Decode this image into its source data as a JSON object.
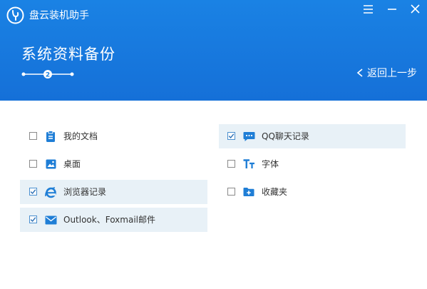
{
  "app": {
    "name": "盘云装机助手",
    "icon": "logo-icon"
  },
  "window_controls": [
    {
      "name": "menu-icon"
    },
    {
      "name": "minimize-icon"
    },
    {
      "name": "close-icon"
    }
  ],
  "page": {
    "title": "系统资料备份",
    "current_step": "2"
  },
  "back": {
    "label": "返回上一步",
    "icon": "chevron-left-icon"
  },
  "options": [
    {
      "key": "documents",
      "label": "我的文档",
      "checked": false,
      "icon": "clipboard-icon"
    },
    {
      "key": "desktop",
      "label": "桌面",
      "checked": false,
      "icon": "image-icon"
    },
    {
      "key": "browser",
      "label": "浏览器记录",
      "checked": true,
      "icon": "ie-icon"
    },
    {
      "key": "mail",
      "label": "Outlook、Foxmail邮件",
      "checked": true,
      "icon": "mail-icon"
    },
    {
      "key": "qq",
      "label": "QQ聊天记录",
      "checked": true,
      "icon": "chat-icon"
    },
    {
      "key": "fonts",
      "label": "字体",
      "checked": false,
      "icon": "font-icon"
    },
    {
      "key": "favorites",
      "label": "收藏夹",
      "checked": false,
      "icon": "folder-plus-icon"
    }
  ],
  "colors": {
    "header": "#1a82e4",
    "accent": "#1a82e4",
    "checked_row": "#e8f1f7",
    "icon": "#1f7ed6"
  }
}
